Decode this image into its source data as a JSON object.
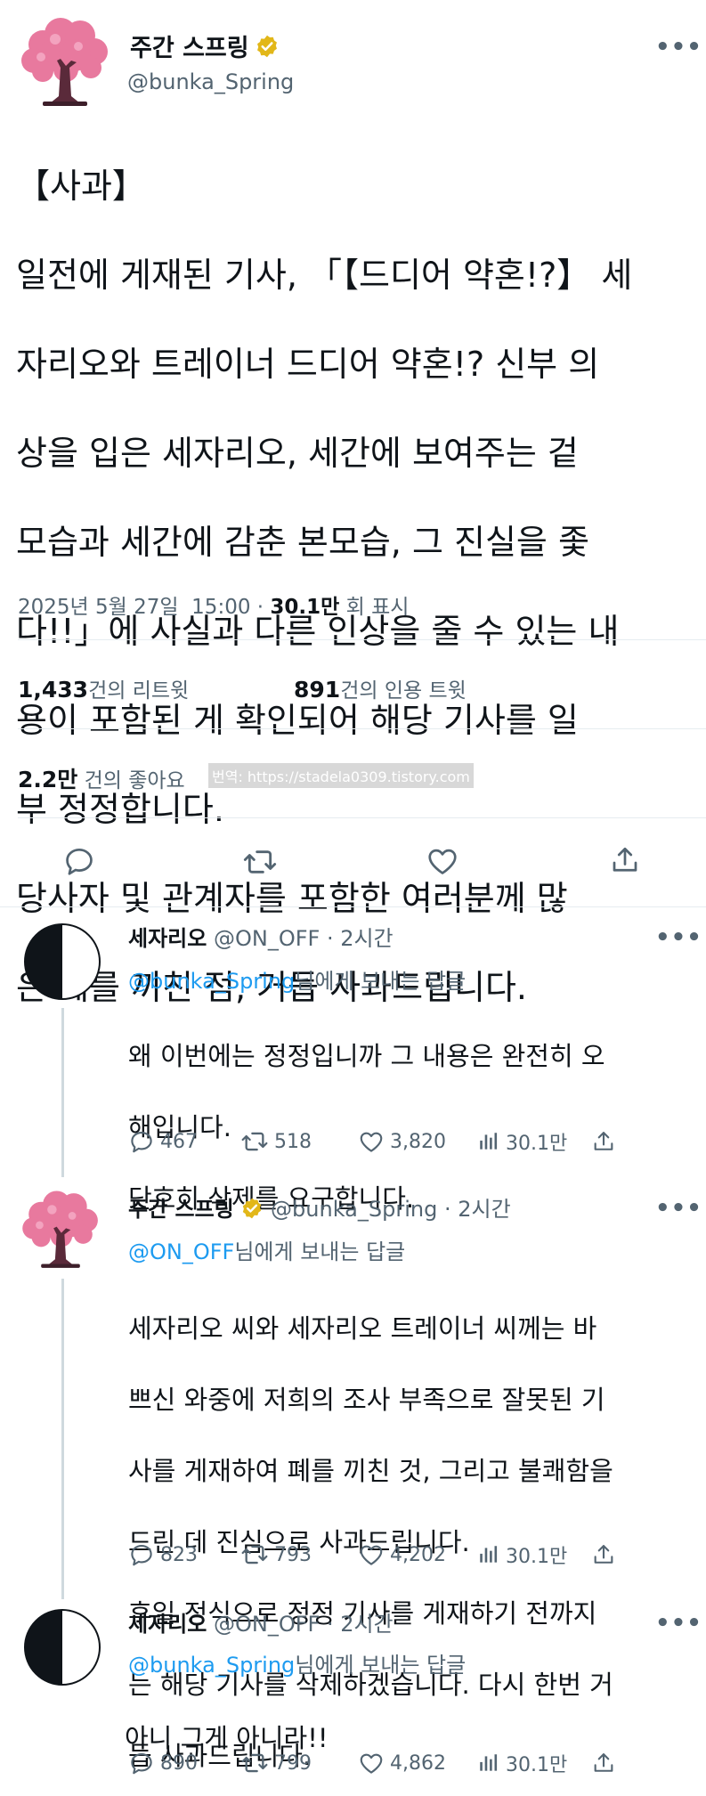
{
  "main_tweet": {
    "name": "주간 스프링",
    "handle": "@bunka_Spring",
    "text_lines": [
      "【사과】",
      "일전에 게재된 기사, 「【드디어 약혼!?】 세",
      "자리오와 트레이너 드디어 약혼!? 신부 의",
      "상을 입은 세자리오, 세간에 보여주는 겉",
      "모습과 세간에 감춘 본모습, 그 진실을 좇",
      "다!!」에 사실과 다른 인상을 줄 수 있는 내",
      "용이 포함된 게 확인되어 해당 기사를 일",
      "부 정정합니다.",
      "당사자 및 관계자를 포함한 여러분께 많",
      "은 폐를 끼친 점, 거듭 사과드립니다."
    ],
    "date": "2025년 5월 27일",
    "time": "15:00",
    "views_count": "30.1만",
    "views_label": "회 표시",
    "retweets_count": "1,433",
    "retweets_label": "건의 리트윗",
    "quotes_count": "891",
    "quotes_label": "건의 인용 트윗",
    "likes_count": "2.2만",
    "likes_label": "건의 좋아요",
    "watermark": "번역: https://stadela0309.tistory.com"
  },
  "replies": [
    {
      "name": "세자리오",
      "handle": "@ON_OFF",
      "time": "· 2시간",
      "reply_to_handle": "@bunka_Spring",
      "reply_to_suffix": "님에게 보내는 답글",
      "text_lines": [
        "왜 이번에는 정정입니까 그 내용은 완전히 오",
        "해입니다.",
        "단호히 삭제를 요구합니다."
      ],
      "replies_count": "467",
      "retweets_count": "518",
      "likes_count": "3,820",
      "views_count": "30.1만"
    },
    {
      "name": "주간 스프링",
      "handle": "@bunka_Spring",
      "time": "· 2시간",
      "reply_to_handle": "@ON_OFF",
      "reply_to_suffix": "님에게 보내는 답글",
      "text_lines": [
        "세자리오 씨와 세자리오 트레이너 씨께는 바",
        "쁘신 와중에 저희의 조사 부족으로 잘못된 기",
        "사를 게재하여 폐를 끼친 것, 그리고 불쾌함을",
        "드린 데 진심으로 사과드립니다.",
        "후일 정식으로 정정 기사를 게재하기 전까지",
        "는 해당 기사를 삭제하겠습니다. 다시 한번 거",
        "듭 사과드립니다."
      ],
      "replies_count": "823",
      "retweets_count": "793",
      "likes_count": "4,202",
      "views_count": "30.1만"
    },
    {
      "name": "세자리오",
      "handle": "@ON_OFF",
      "time": "· 2시간",
      "reply_to_handle": "@bunka_Spring",
      "reply_to_suffix": "님에게 보내는 답글",
      "text_lines": [
        "아니 그게 아니라!!"
      ],
      "replies_count": "890",
      "retweets_count": "799",
      "likes_count": "4,862",
      "views_count": "30.1만"
    }
  ],
  "icons": {
    "more": "more-icon",
    "verified": "verified-badge-icon",
    "reply": "reply-icon",
    "retweet": "retweet-icon",
    "like": "heart-icon",
    "views": "views-icon",
    "share": "share-icon"
  },
  "colors": {
    "link": "#1d9bf0",
    "secondary_text": "#536471",
    "verified_badge": "#e2b719",
    "cherry_blossom": "#e8799e",
    "trunk": "#5a2a3a"
  },
  "more_label": "•••"
}
